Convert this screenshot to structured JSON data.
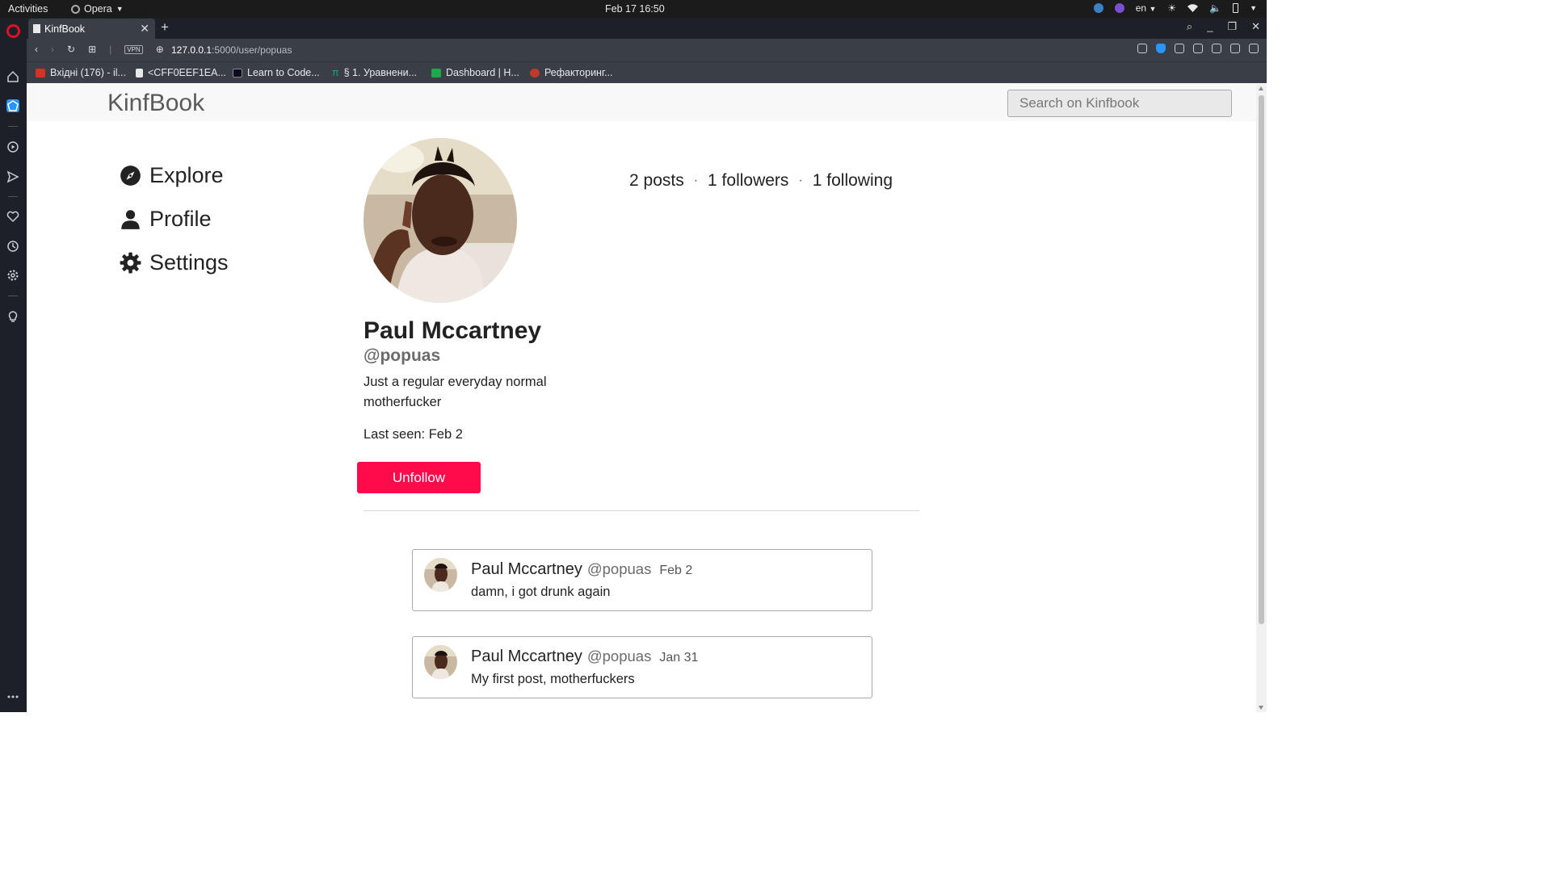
{
  "system_bar": {
    "activities": "Activities",
    "app_name": "Opera",
    "clock": "Feb 17  16:50",
    "language": "en"
  },
  "browser": {
    "tab_title": "KinfBook",
    "url_host": "127.0.0.1",
    "url_path": ":5000/user/popuas",
    "vpn_label": "VPN",
    "bookmarks": [
      {
        "label": "Вхідні (176) - il...",
        "icon": "gmail-icon",
        "color": "#d93025"
      },
      {
        "label": "<CFF0EEF1EA...",
        "icon": "document-icon",
        "color": "#e8e8e8"
      },
      {
        "label": "Learn to Code...",
        "icon": "freecodecamp-icon",
        "color": "#0a0a23"
      },
      {
        "label": "§ 1. Уравнени...",
        "icon": "pi-icon",
        "color": "#1aa37a"
      },
      {
        "label": "Dashboard | H...",
        "icon": "hackerrank-icon",
        "color": "#1ba94c"
      },
      {
        "label": "Рефакторинг...",
        "icon": "refactoring-icon",
        "color": "#c0392b"
      }
    ]
  },
  "site": {
    "brand": "KinfBook",
    "search_placeholder": "Search on Kinfbook",
    "nav": {
      "explore": "Explore",
      "profile": "Profile",
      "settings": "Settings"
    }
  },
  "profile": {
    "name": "Paul Mccartney",
    "handle": "@popuas",
    "bio": "Just a regular everyday normal motherfucker",
    "last_seen": "Last seen: Feb 2",
    "stats": {
      "posts": "2 posts",
      "followers": "1 followers",
      "following": "1 following",
      "separator": "·"
    },
    "follow_button": "Unfollow"
  },
  "posts": [
    {
      "name": "Paul Mccartney",
      "handle": "@popuas",
      "date": "Feb 2",
      "text": "damn, i got drunk again"
    },
    {
      "name": "Paul Mccartney",
      "handle": "@popuas",
      "date": "Jan 31",
      "text": "My first post, motherfuckers"
    }
  ],
  "colors": {
    "accent": "#ff0a4a",
    "opera_red": "#e0102a",
    "chrome_dark": "#1d2026",
    "chrome_mid": "#3a3f47"
  }
}
